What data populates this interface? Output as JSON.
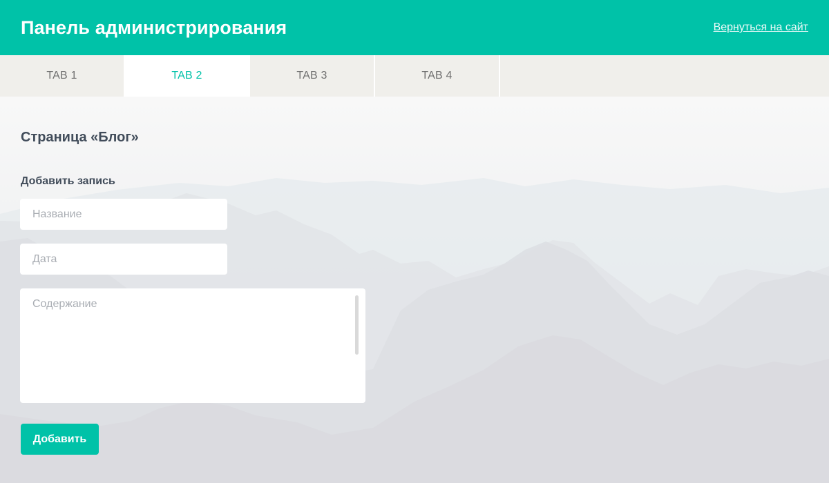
{
  "header": {
    "title": "Панель администрирования",
    "back_link": "Вернуться на сайт"
  },
  "tabs": [
    {
      "label": "TAB 1",
      "active": false
    },
    {
      "label": "TAB 2",
      "active": true
    },
    {
      "label": "TAB 3",
      "active": false
    },
    {
      "label": "TAB 4",
      "active": false
    }
  ],
  "page": {
    "title": "Страница «Блог»",
    "section_label": "Добавить запись"
  },
  "form": {
    "title_placeholder": "Название",
    "title_value": "",
    "date_placeholder": "Дата",
    "date_value": "",
    "content_placeholder": "Содержание",
    "content_value": "",
    "submit_label": "Добавить"
  },
  "colors": {
    "accent": "#00c2a8",
    "tab_bar": "#f0efeb",
    "text": "#414c5a",
    "placeholder": "#a9adb3"
  }
}
